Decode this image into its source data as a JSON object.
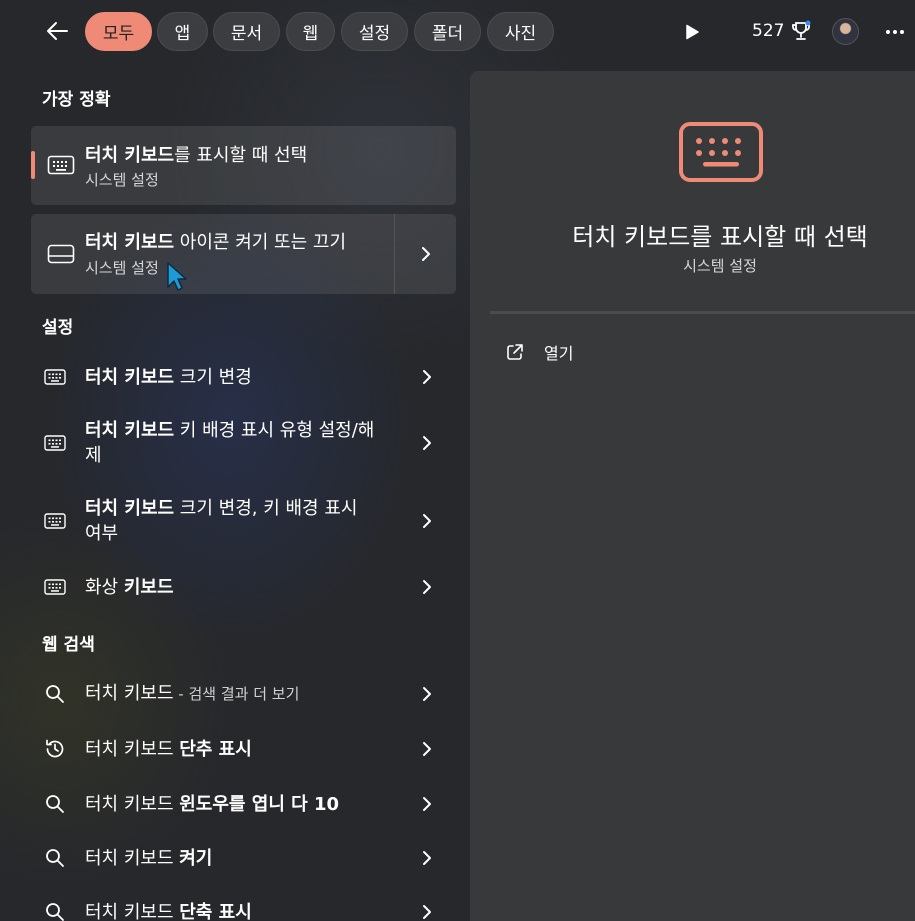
{
  "toolbar": {
    "filters": [
      "모두",
      "앱",
      "문서",
      "웹",
      "설정",
      "폴더",
      "사진"
    ],
    "points": "527",
    "accent_color": "#ee8a75"
  },
  "best_match": {
    "heading": "가장 정확",
    "items": [
      {
        "title_bold": "터치 키보드",
        "title_rest": "를 표시할 때 선택",
        "subtitle": "시스템 설정",
        "icon": "keyboard-icon"
      },
      {
        "title_bold": "터치 키보드",
        "title_rest": " 아이콘 켜기 또는 끄기",
        "subtitle": "시스템 설정",
        "icon": "taskbar-icon"
      }
    ]
  },
  "settings": {
    "heading": "설정",
    "items": [
      {
        "bold": "터치 키보드",
        "rest": " 크기 변경"
      },
      {
        "bold": "터치 키보드",
        "rest": " 키 배경 표시 유형 설정/해제"
      },
      {
        "bold": "터치 키보드",
        "rest": " 크기 변경, 키 배경 표시 여부"
      },
      {
        "rest": "화상 ",
        "bold": "키보드"
      }
    ]
  },
  "web": {
    "heading": "웹 검색",
    "items": [
      {
        "plain": "터치 키보드",
        "suffix": " - 검색 결과 더 보기",
        "icon": "search-icon"
      },
      {
        "plain": "터치 키보드 ",
        "bold": "단추 표시",
        "icon": "history-icon"
      },
      {
        "plain": "터치 키보드 ",
        "bold": "윈도우를 엽니 다 10",
        "icon": "search-icon"
      },
      {
        "plain": "터치 키보드 ",
        "bold": "켜기",
        "icon": "search-icon"
      },
      {
        "plain": "터치 키보드 ",
        "bold": "단축 표시",
        "icon": "search-icon"
      }
    ]
  },
  "preview": {
    "title": "터치 키보드를 표시할 때 선택",
    "subtitle": "시스템 설정",
    "open_label": "열기"
  }
}
